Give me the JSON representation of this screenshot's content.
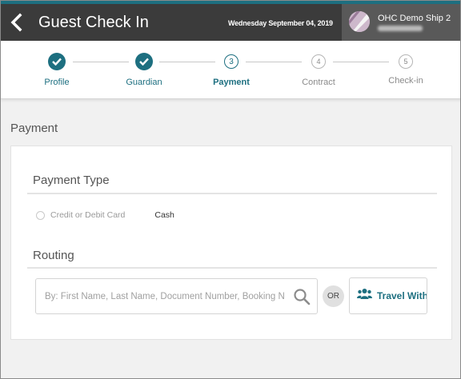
{
  "header": {
    "title": "Guest Check In",
    "date": "Wednesday September 04, 2019",
    "ship_name": "OHC Demo Ship 2"
  },
  "steps": [
    {
      "label": "Profile",
      "state": "done",
      "number": "1"
    },
    {
      "label": "Guardian",
      "state": "done",
      "number": "2"
    },
    {
      "label": "Payment",
      "state": "active",
      "number": "3"
    },
    {
      "label": "Contract",
      "state": "todo",
      "number": "4"
    },
    {
      "label": "Check-in",
      "state": "todo",
      "number": "5"
    }
  ],
  "main": {
    "section_title": "Payment",
    "payment_type": {
      "heading": "Payment Type",
      "options": [
        "Credit or Debit Card",
        "Cash"
      ]
    },
    "routing": {
      "heading": "Routing",
      "search_placeholder": "By: First Name, Last Name, Document Number, Booking N",
      "or_label": "OR",
      "travel_with_label": "Travel With"
    }
  },
  "colors": {
    "accent": "#1d6f80",
    "header_bg": "#3b3b3b",
    "user_bg": "#595959"
  }
}
